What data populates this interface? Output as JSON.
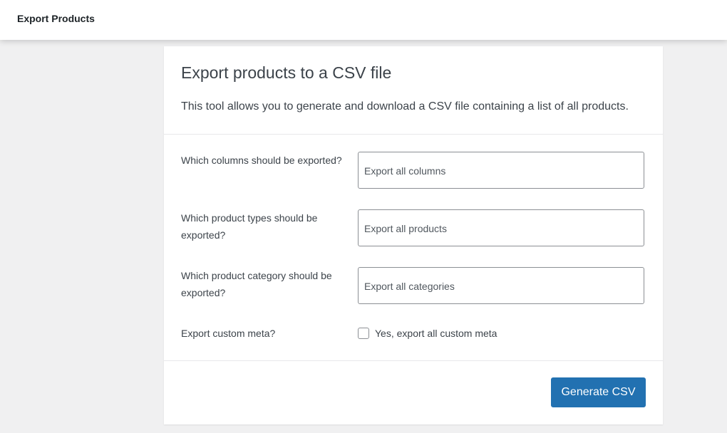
{
  "header": {
    "title": "Export Products"
  },
  "card": {
    "title": "Export products to a CSV file",
    "description": "This tool allows you to generate and download a CSV file containing a list of all products."
  },
  "form": {
    "columns_label": "Which columns should be exported?",
    "columns_placeholder": "Export all columns",
    "types_label": "Which product types should be exported?",
    "types_placeholder": "Export all products",
    "category_label": "Which product category should be exported?",
    "category_placeholder": "Export all categories",
    "meta_label": "Export custom meta?",
    "meta_checkbox_label": "Yes, export all custom meta",
    "meta_checked": false
  },
  "footer": {
    "generate_label": "Generate CSV"
  },
  "colors": {
    "primary": "#2271b1",
    "background": "#f0f0f1"
  }
}
